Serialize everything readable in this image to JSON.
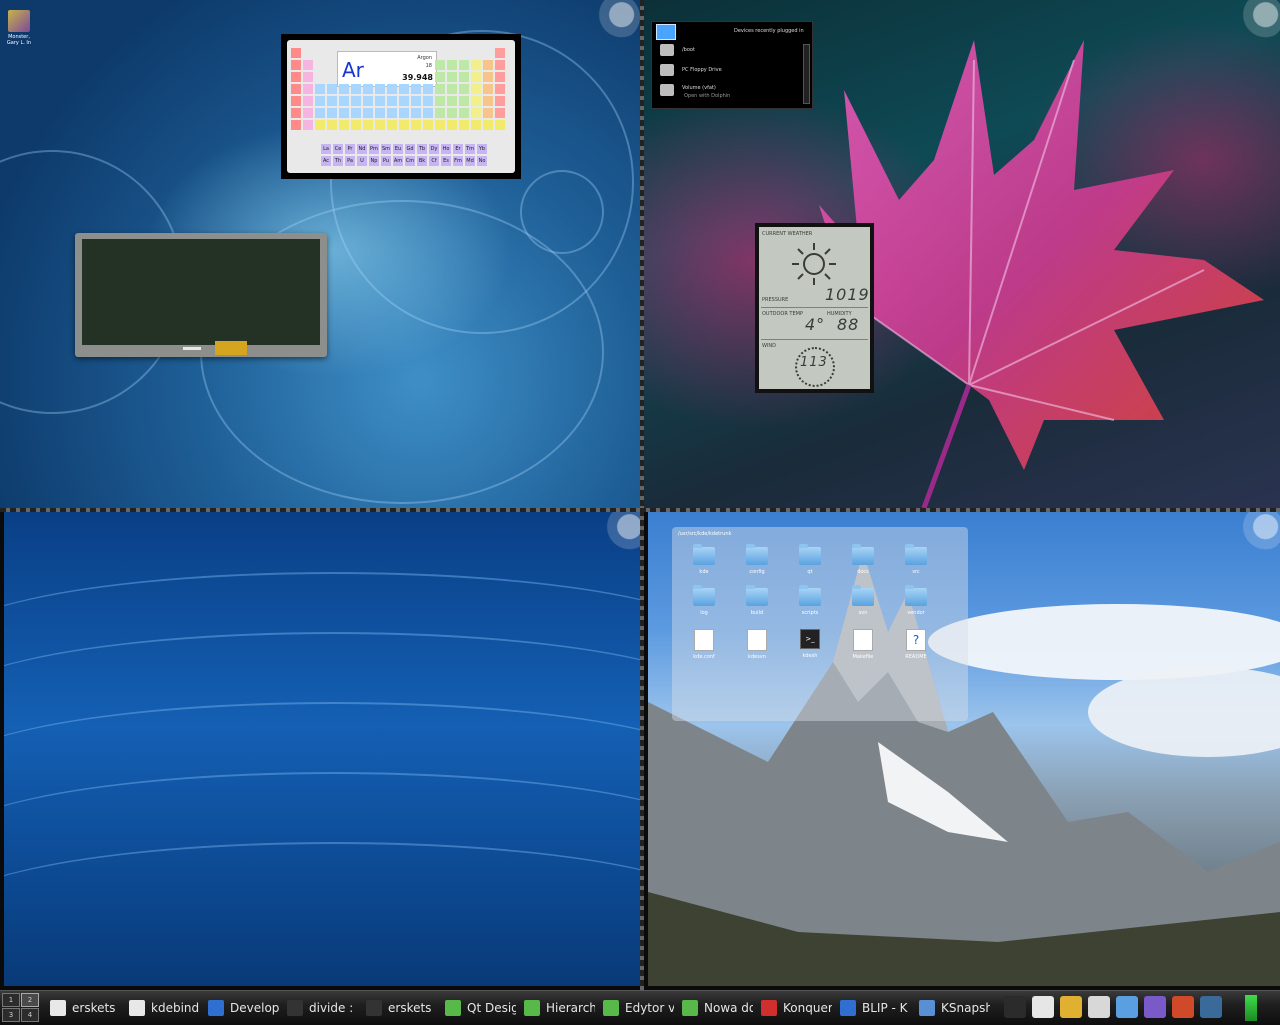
{
  "desktop_icon": {
    "label_line1": "Monster,",
    "label_line2": "Gary L. In"
  },
  "periodic_table": {
    "selected": {
      "symbol": "Ar",
      "name": "Argon",
      "number": "18",
      "mass": "39.948"
    },
    "f_block_row1": [
      "La",
      "Ce",
      "Pr",
      "Nd",
      "Pm",
      "Sm",
      "Eu",
      "Gd",
      "Tb",
      "Dy",
      "Ho",
      "Er",
      "Tm",
      "Yb"
    ],
    "f_block_row2": [
      "Ac",
      "Th",
      "Pa",
      "U",
      "Np",
      "Pu",
      "Am",
      "Cm",
      "Bk",
      "Cf",
      "Es",
      "Fm",
      "Md",
      "No"
    ]
  },
  "device_notifier": {
    "title": "Devices recently plugged in",
    "devices": [
      {
        "name": "/boot",
        "sub": ""
      },
      {
        "name": "PC Floppy Drive",
        "sub": ""
      },
      {
        "name": "Volume (vfat)",
        "sub": "Open with Dolphin"
      }
    ]
  },
  "weather": {
    "current_label": "CURRENT WEATHER",
    "pressure_label": "PRESSURE",
    "pressure_value": "1019",
    "outdoor_label": "OUTDOOR TEMP",
    "outdoor_value": "4°",
    "humidity_label": "HUMIDITY",
    "humidity_value": "88",
    "wind_label": "WIND",
    "wind_value": "113"
  },
  "folder_view": {
    "path": "/usr/src/kde/kdetrunk",
    "items": [
      {
        "label": "kde",
        "kind": "folder"
      },
      {
        "label": "config",
        "kind": "folder"
      },
      {
        "label": "qt",
        "kind": "folder"
      },
      {
        "label": "docs",
        "kind": "folder"
      },
      {
        "label": "src",
        "kind": "folder"
      },
      {
        "label": "log",
        "kind": "folder"
      },
      {
        "label": "build",
        "kind": "folder"
      },
      {
        "label": "scripts",
        "kind": "folder"
      },
      {
        "label": "svn",
        "kind": "folder"
      },
      {
        "label": "vendor",
        "kind": "folder"
      },
      {
        "label": "kde.conf",
        "kind": "file"
      },
      {
        "label": "kdesvn",
        "kind": "file"
      },
      {
        "label": "kdesh",
        "kind": "terminal"
      },
      {
        "label": "Makefile",
        "kind": "file"
      },
      {
        "label": "README",
        "kind": "help"
      }
    ]
  },
  "taskbar": {
    "pager": [
      "1",
      "2",
      "3",
      "4"
    ],
    "tasks": [
      {
        "label": "erskets",
        "color": "#e8e8e8"
      },
      {
        "label": "kdebindi",
        "color": "#e8e8e8"
      },
      {
        "label": "Develop",
        "color": "#2f6fd1"
      },
      {
        "label": "divide :",
        "color": "#333333"
      },
      {
        "label": "erskets",
        "color": "#333333"
      },
      {
        "label": "Qt Desig",
        "color": "#59b84a"
      },
      {
        "label": "Hierarch",
        "color": "#59b84a"
      },
      {
        "label": "Edytor v",
        "color": "#59b84a"
      },
      {
        "label": "Nowa do",
        "color": "#59b84a"
      },
      {
        "label": "Konquer",
        "color": "#d12e2e"
      },
      {
        "label": "BLIP - K",
        "color": "#2f6fd1"
      },
      {
        "label": "KSnapsh",
        "color": "#5a8fd6"
      }
    ],
    "tray_colors": [
      "#2b2b2b",
      "#e6e6e6",
      "#e0b030",
      "#d8d8d8",
      "#5aa0e0",
      "#7a5ac8",
      "#d04a2a",
      "#3a6a9a"
    ]
  }
}
